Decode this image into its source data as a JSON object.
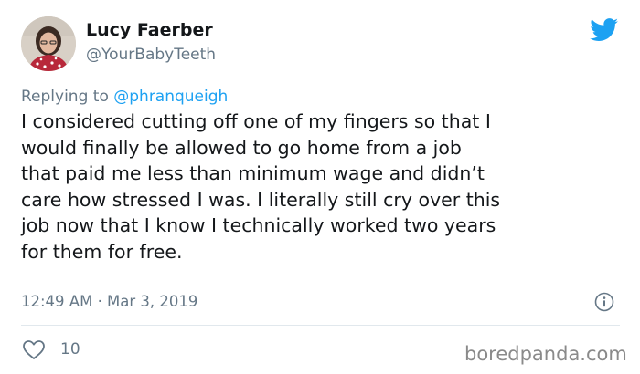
{
  "author": {
    "display_name": "Lucy Faerber",
    "handle": "@YourBabyTeeth"
  },
  "reply": {
    "prefix": "Replying to ",
    "mention": "@phranqueigh"
  },
  "tweet": {
    "lines": [
      "I considered cutting off one of my fingers so that I",
      "would finally be allowed to go home from a job",
      "that paid me less than minimum wage and didn’t",
      "care how stressed I was. I literally still cry over this",
      "job now that I know I technically worked two years",
      "for them for free."
    ],
    "timestamp": "12:49 AM · Mar 3, 2019"
  },
  "engagement": {
    "likes": "10"
  },
  "watermark": "boredpanda.com",
  "icons": {
    "brand": "twitter-bird-icon",
    "info": "info-icon",
    "like": "heart-icon"
  },
  "colors": {
    "twitter_blue": "#1da1f2",
    "secondary_text": "#657786",
    "primary_text": "#14171a",
    "divider": "#e1e8ed"
  }
}
